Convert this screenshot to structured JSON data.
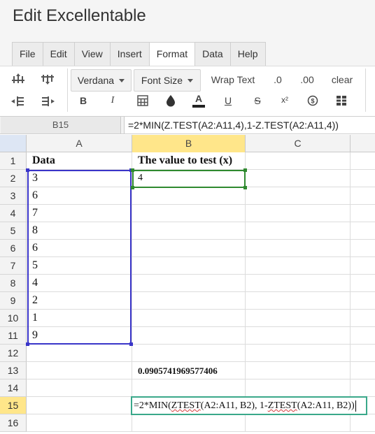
{
  "app": {
    "title": "Edit Excellentable"
  },
  "menu": {
    "tabs": [
      "File",
      "Edit",
      "View",
      "Insert",
      "Format",
      "Data",
      "Help"
    ],
    "active": "Format"
  },
  "toolbar": {
    "font_family": "Verdana",
    "font_size": "Font Size",
    "wrap_text": "Wrap Text",
    "decimal_one": ".0",
    "decimal_two": ".00",
    "clear": "clear",
    "bold": "B",
    "italic": "I",
    "text_color": "A",
    "underline": "U",
    "strike": "S",
    "superscript": "x²"
  },
  "formula_bar": {
    "cell_ref": "B15",
    "formula": "=2*MIN(Z.TEST(A2:A11,4),1-Z.TEST(A2:A11,4))"
  },
  "grid": {
    "columns": [
      "A",
      "B",
      "C"
    ],
    "rows": [
      "1",
      "2",
      "3",
      "4",
      "5",
      "6",
      "7",
      "8",
      "9",
      "10",
      "11",
      "12",
      "13",
      "14",
      "15",
      "16"
    ],
    "a1": "Data",
    "b1": "The value to test (x)",
    "a_values": [
      "3",
      "6",
      "7",
      "8",
      "6",
      "5",
      "4",
      "2",
      "1",
      "9"
    ],
    "b2": "4",
    "b13": "0.0905741969577406"
  },
  "editor": {
    "prefix": "=2*MIN(",
    "fn1": "ZTEST",
    "mid1": "(A2:A11, B2), 1-",
    "fn2": "ZTEST",
    "mid2": "(A2:A11, B2))"
  },
  "colors": {
    "range_border": "#3a35c9",
    "active_border": "#2f8a2f",
    "editor_border": "#3aa88a",
    "header_selected": "#ffe68a"
  }
}
